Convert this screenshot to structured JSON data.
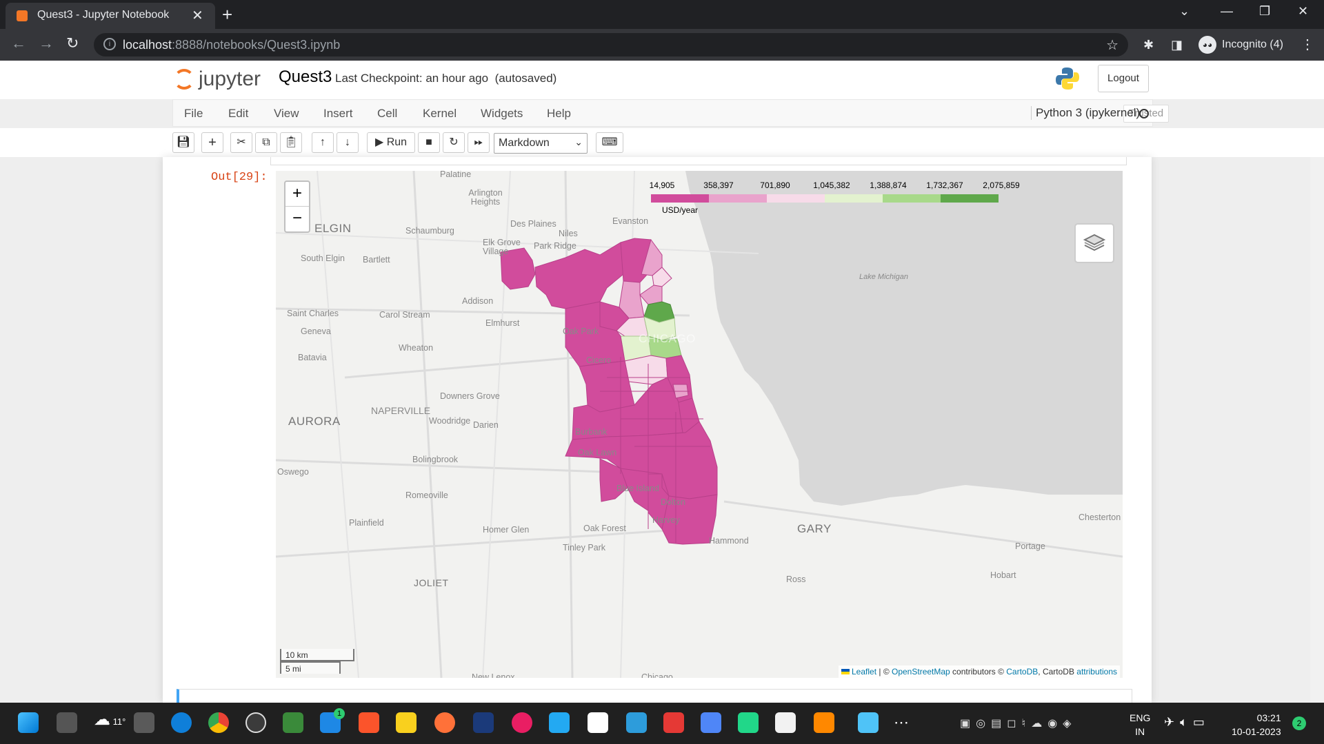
{
  "browser": {
    "tab_title": "Quest3 - Jupyter Notebook",
    "url_host": "localhost",
    "url_rest": ":8888/notebooks/Quest3.ipynb",
    "profile_label": "Incognito (4)"
  },
  "jupyter": {
    "logo_text": "jupyter",
    "notebook_name": "Quest3",
    "checkpoint": "Last Checkpoint: an hour ago",
    "autosaved": "(autosaved)",
    "logout_label": "Logout",
    "menus": [
      "File",
      "Edit",
      "View",
      "Insert",
      "Cell",
      "Kernel",
      "Widgets",
      "Help"
    ],
    "trusted_label": "Trusted",
    "kernel_name": "Python 3 (ipykernel)",
    "run_label": "Run",
    "cell_type": "Markdown",
    "out_prompt": "Out[29]:"
  },
  "map": {
    "legend_ticks": [
      "14,905",
      "358,397",
      "701,890",
      "1,045,382",
      "1,388,874",
      "1,732,367",
      "2,075,859"
    ],
    "legend_unit": "USD/year",
    "legend_colors": [
      "#d14c9c",
      "#e9a3cc",
      "#f7dbe9",
      "#e3f2cf",
      "#a8d98a",
      "#5fa84b"
    ],
    "zoom_in": "+",
    "zoom_out": "−",
    "scale_km": "10 km",
    "scale_mi": "5 mi",
    "attribution": {
      "leaflet": "Leaflet",
      "sep1": " | © ",
      "osm": "OpenStreetMap",
      "contrib": " contributors © ",
      "cartodb": "CartoDB",
      "mid": ", CartoDB ",
      "attributions": "attributions"
    },
    "place_labels": [
      "Palatine",
      "Arlington Heights",
      "Des Plaines",
      "Evanston",
      "Niles",
      "ELGIN",
      "Schaumburg",
      "Elk Grove Village",
      "Park Ridge",
      "South Elgin",
      "Bartlett",
      "Lake Michigan",
      "Addison",
      "Saint Charles",
      "Carol Stream",
      "Elmhurst",
      "Oak Park",
      "CHICAGO",
      "Geneva",
      "Wheaton",
      "Batavia",
      "Cicero",
      "Downers Grove",
      "NAPERVILLE",
      "AURORA",
      "Woodridge",
      "Darien",
      "Burbank",
      "Oak Lawn",
      "Bolingbrook",
      "Oswego",
      "Blue Island",
      "Romeoville",
      "Dolton",
      "Harvey",
      "Plainfield",
      "Homer Glen",
      "Oak Forest",
      "GARY",
      "Chesterton",
      "Hammond",
      "Tinley Park",
      "Portage",
      "JOLIET",
      "Hobart",
      "New Lenox",
      "Ross",
      "Chicago"
    ]
  },
  "taskbar": {
    "weather_temp": "11°",
    "lang_line1": "ENG",
    "lang_line2": "IN",
    "time": "03:21",
    "date": "10-01-2023",
    "notification_count": "2",
    "tasks_badge": "1"
  }
}
